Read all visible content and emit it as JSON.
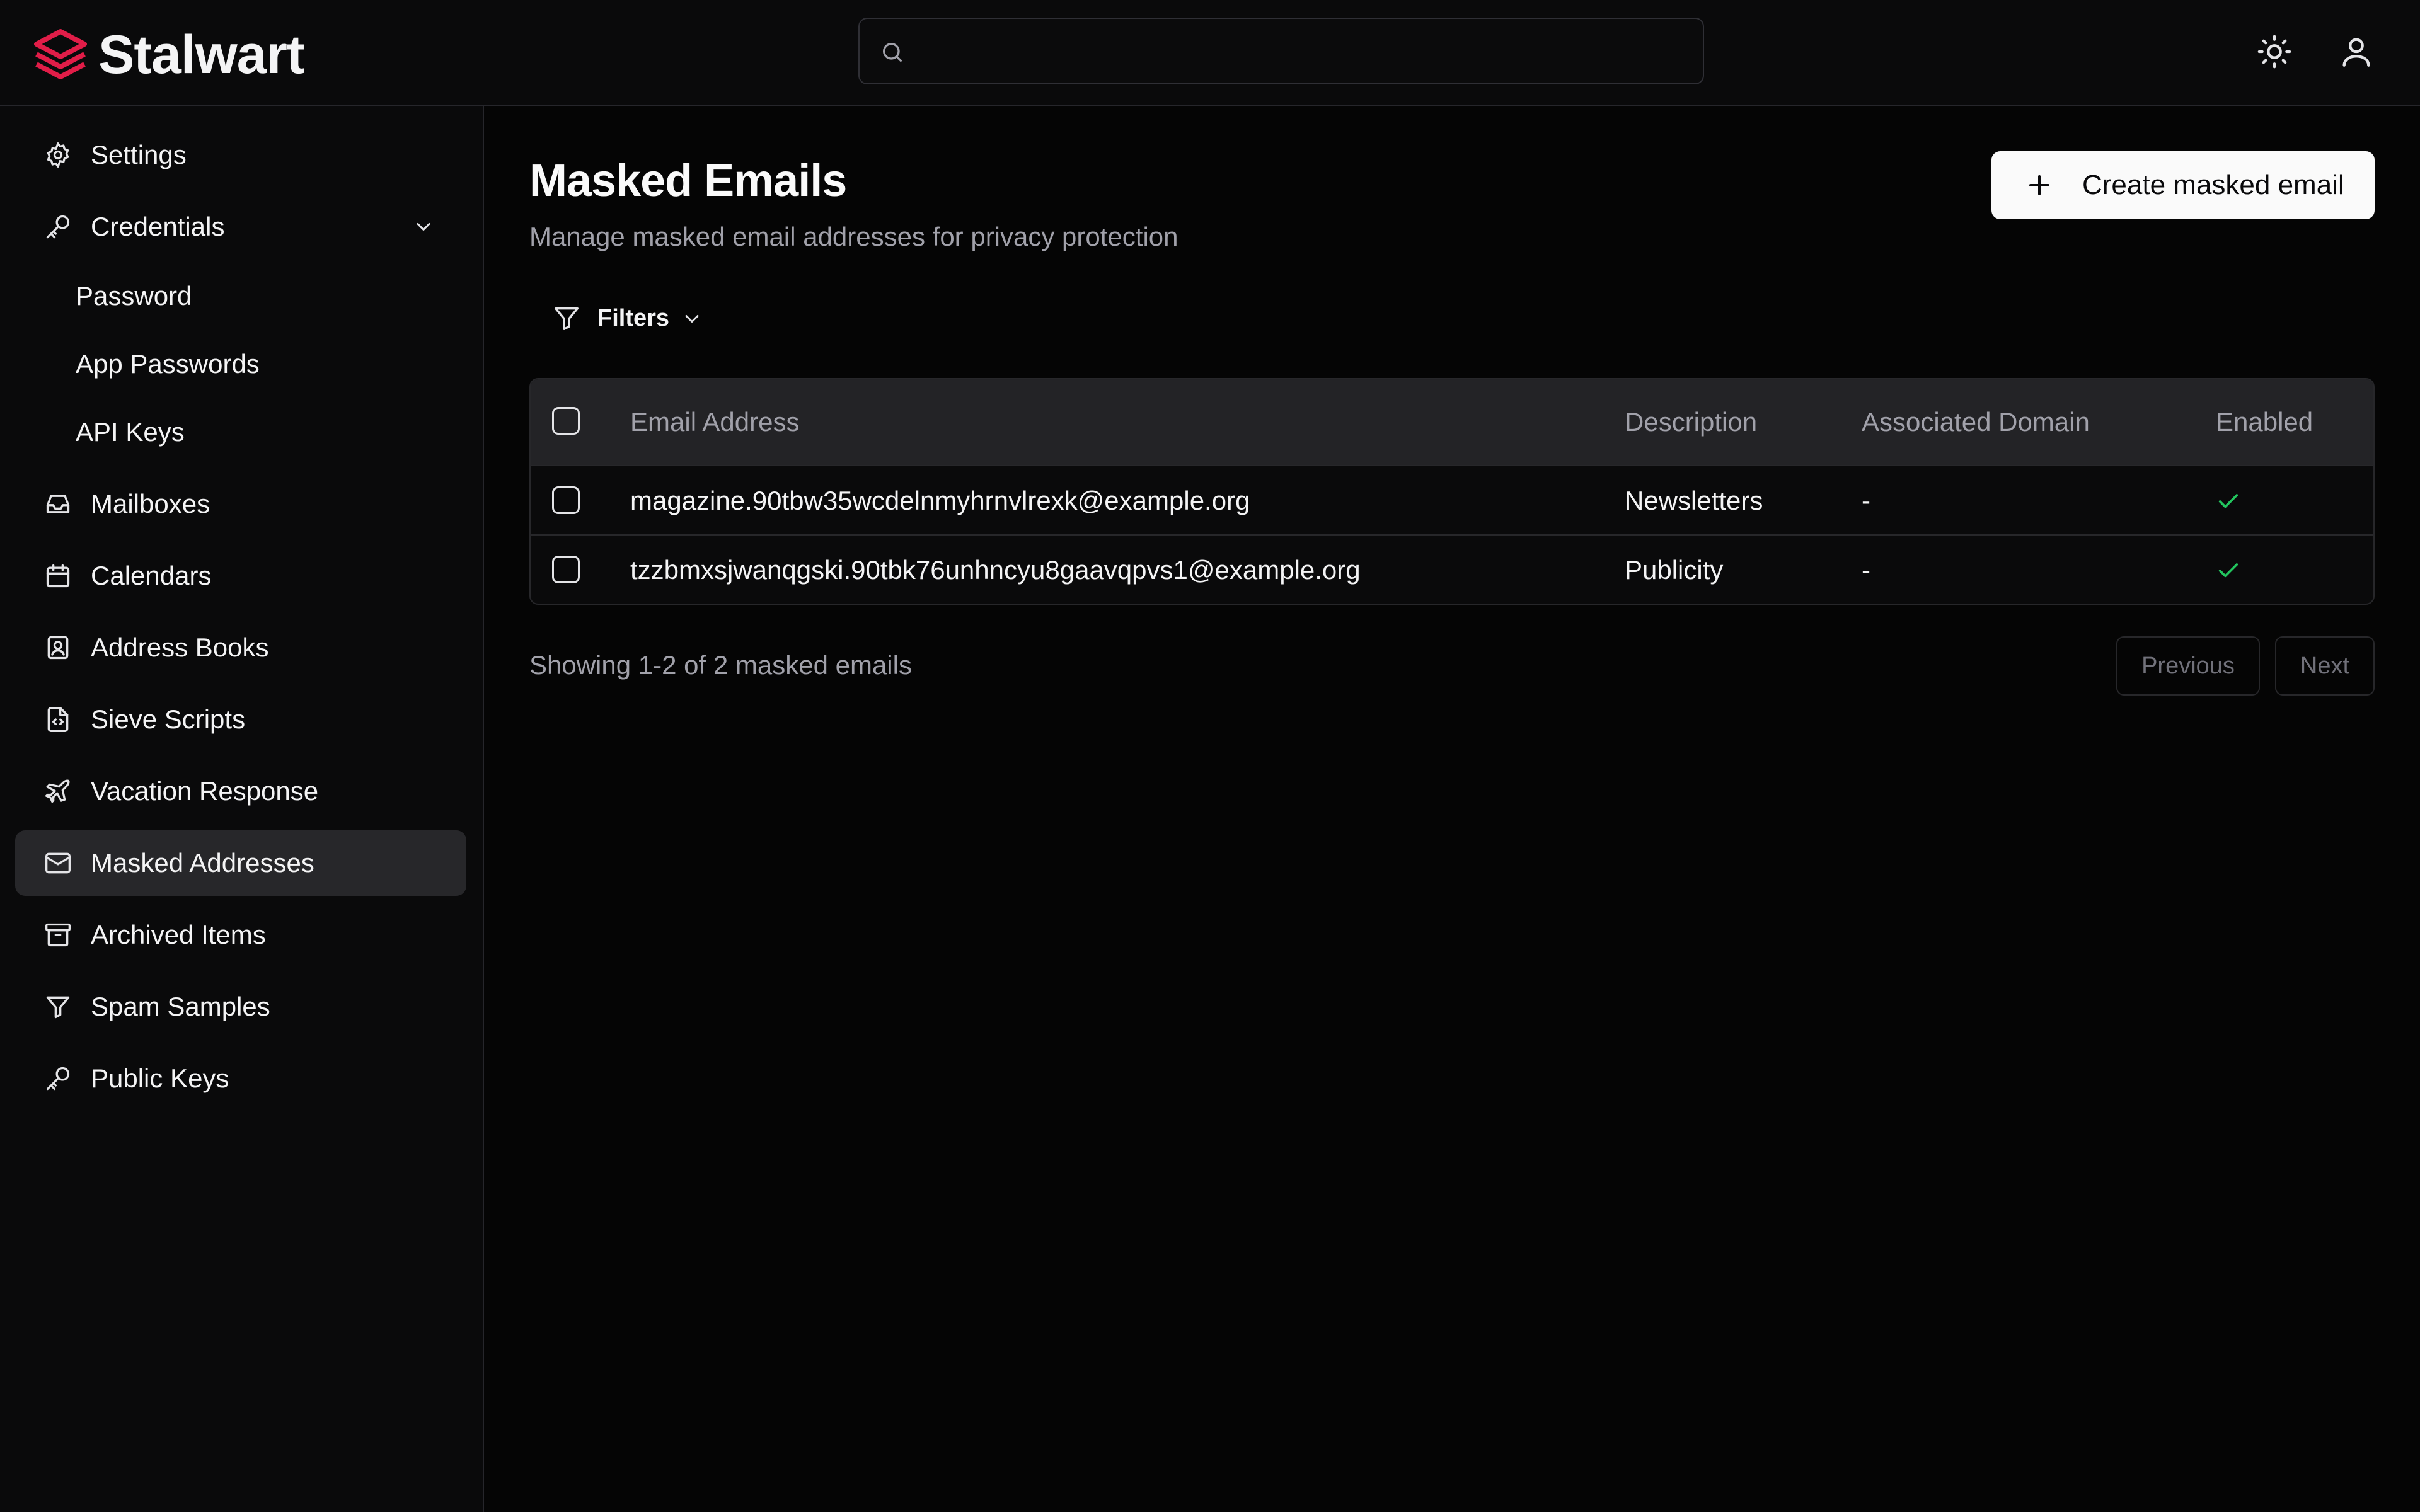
{
  "app": {
    "name": "Stalwart",
    "brand_color": "#e11d48"
  },
  "search": {
    "placeholder": ""
  },
  "header_icons": [
    "sun-icon",
    "user-icon"
  ],
  "sidebar": {
    "items": [
      {
        "label": "Settings",
        "icon": "gear-icon"
      },
      {
        "label": "Credentials",
        "icon": "key-icon",
        "expanded": true,
        "children": [
          {
            "label": "Password"
          },
          {
            "label": "App Passwords"
          },
          {
            "label": "API Keys"
          }
        ]
      },
      {
        "label": "Mailboxes",
        "icon": "inbox-icon"
      },
      {
        "label": "Calendars",
        "icon": "calendar-icon"
      },
      {
        "label": "Address Books",
        "icon": "contact-book-icon"
      },
      {
        "label": "Sieve Scripts",
        "icon": "file-code-icon"
      },
      {
        "label": "Vacation Response",
        "icon": "plane-icon"
      },
      {
        "label": "Masked Addresses",
        "icon": "mail-icon",
        "active": true
      },
      {
        "label": "Archived Items",
        "icon": "archive-icon"
      },
      {
        "label": "Spam Samples",
        "icon": "funnel-icon"
      },
      {
        "label": "Public Keys",
        "icon": "key-icon"
      }
    ]
  },
  "main": {
    "title": "Masked Emails",
    "subtitle": "Manage masked email addresses for privacy protection",
    "create_label": "Create masked email",
    "filters_label": "Filters",
    "table": {
      "columns": [
        "Email Address",
        "Description",
        "Associated Domain",
        "Enabled"
      ],
      "rows": [
        {
          "email": "magazine.90tbw35wcdelnmyhrnvlrexk@example.org",
          "description": "Newsletters",
          "domain": "-",
          "enabled": true
        },
        {
          "email": "tzzbmxsjwanqgski.90tbk76unhncyu8gaavqpvs1@example.org",
          "description": "Publicity",
          "domain": "-",
          "enabled": true
        }
      ]
    },
    "showing": "Showing 1-2 of 2 masked emails",
    "pagination": {
      "previous": "Previous",
      "next": "Next"
    },
    "enabled_color": "#22c55e"
  }
}
